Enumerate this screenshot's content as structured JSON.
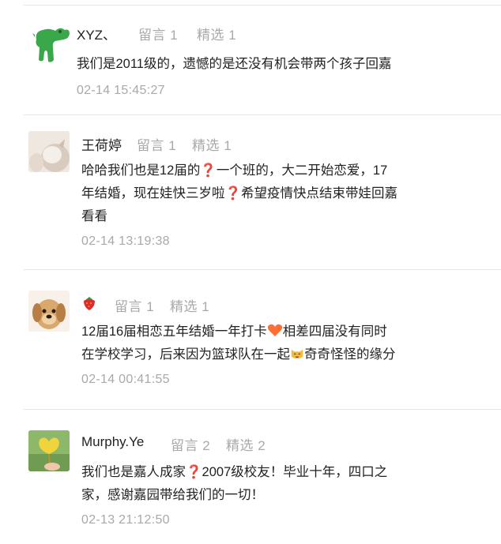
{
  "comments": [
    {
      "name": "XYZ、",
      "replies": "留言 1",
      "featured": "精选 1",
      "content": "我们是2011级的，遗憾的是还没有机会带两个孩子回嘉",
      "time": "02-14 15:45:27",
      "avatar": "green-dinosaur-avatar"
    },
    {
      "name": "王荷婷",
      "replies": "留言 1",
      "featured": "精选 1",
      "content_parts": [
        "哈哈我们也是12届的",
        "一个班的，大二开始恋爱，17年结婚，现在娃快三岁啦",
        "希望疫情快点结束带娃回嘉看看"
      ],
      "content_lines": [
        "一个班的，大二开始恋爱，17",
        "年结婚，现在娃快三岁啦",
        "希望疫情快点结束带娃回嘉",
        "看看"
      ],
      "time": "02-14 13:19:38",
      "avatar": "cat-photo-avatar"
    },
    {
      "name": "",
      "replies": "留言 1",
      "featured": "精选 1",
      "content_a": "12届16届相恋五年结婚一年打卡",
      "content_b": "相差四届没有同时",
      "content_c": "在学校学习，后来因为篮球队在一起",
      "content_d": "奇奇怪怪的缘分",
      "time": "02-14 00:41:55",
      "avatar": "dog-photo-avatar"
    },
    {
      "name": "Murphy.Ye",
      "replies": "留言 2",
      "featured": "精选 2",
      "content_a": "我们也是嘉人成家",
      "content_b": "2007级校友！毕业十年，四口之",
      "content_c": "家，感谢嘉园带给我们的一切！",
      "time": "02-13 21:12:50",
      "avatar": "ginkgo-leaf-avatar"
    }
  ],
  "icons": {
    "question": "❓",
    "heart": "🧡",
    "strawberry": "🍓",
    "cat_face": "😸"
  },
  "colors": {
    "meta": "#a9a9a9",
    "question": "#d43a3a",
    "heart": "#ff6e35"
  }
}
